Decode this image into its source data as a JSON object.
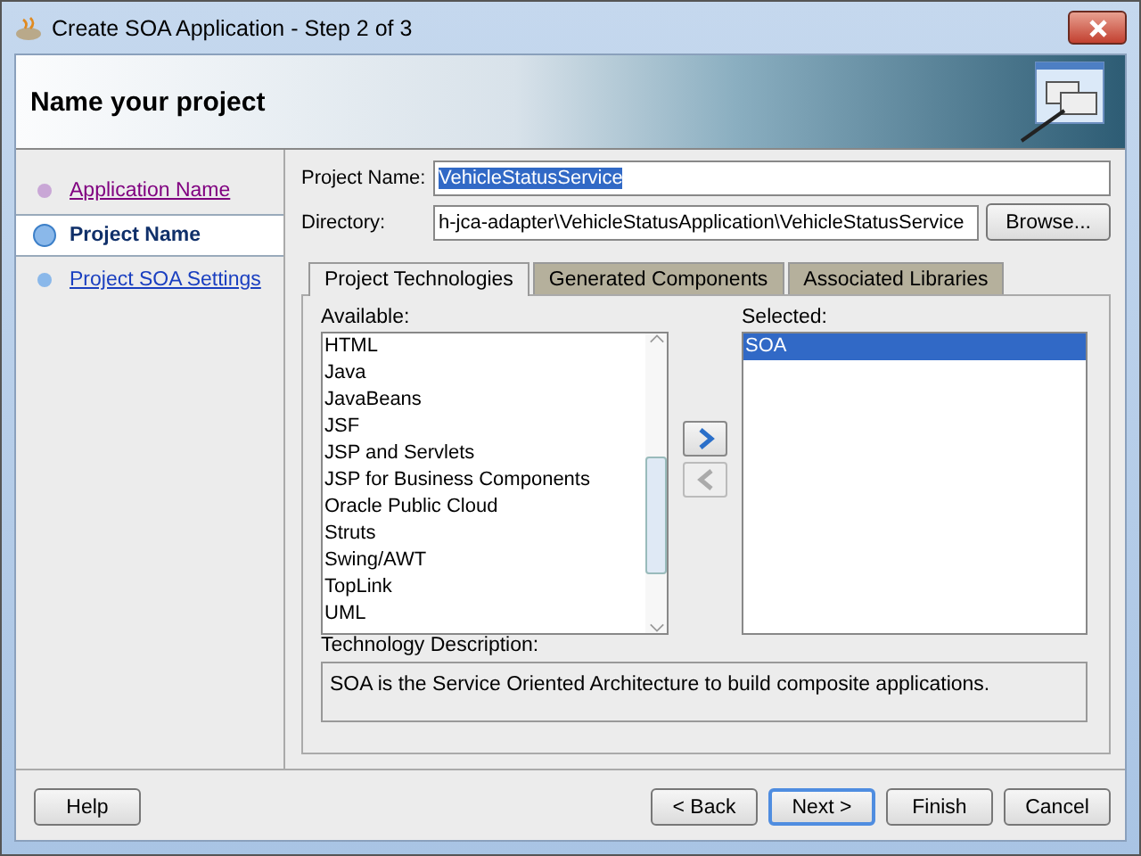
{
  "window": {
    "title": "Create SOA Application - Step 2 of 3"
  },
  "header": {
    "title": "Name your project"
  },
  "steps": [
    {
      "label": "Application Name",
      "selected": false,
      "visited": true
    },
    {
      "label": "Project Name",
      "selected": true,
      "visited": false
    },
    {
      "label": "Project SOA Settings",
      "selected": false,
      "visited": false
    }
  ],
  "project_name": {
    "label": "Project Name:",
    "value": "VehicleStatusService"
  },
  "directory": {
    "label": "Directory:",
    "value": "h-jca-adapter\\VehicleStatusApplication\\VehicleStatusService",
    "browse": "Browse..."
  },
  "tabs": [
    {
      "label": "Project Technologies",
      "selected": true
    },
    {
      "label": "Generated Components",
      "selected": false
    },
    {
      "label": "Associated Libraries",
      "selected": false
    }
  ],
  "available": {
    "label": "Available:",
    "items": [
      {
        "label": "HTML",
        "selected": false
      },
      {
        "label": "Java",
        "selected": false
      },
      {
        "label": "JavaBeans",
        "selected": false
      },
      {
        "label": "JSF",
        "selected": false
      },
      {
        "label": "JSP and Servlets",
        "selected": false
      },
      {
        "label": "JSP for Business Components",
        "selected": false
      },
      {
        "label": "Oracle Public Cloud",
        "selected": false
      },
      {
        "label": "Struts",
        "selected": false
      },
      {
        "label": "Swing/AWT",
        "selected": false
      },
      {
        "label": "TopLink",
        "selected": false
      },
      {
        "label": "UML",
        "selected": false
      }
    ]
  },
  "selected_list": {
    "label": "Selected:",
    "items": [
      {
        "label": "SOA",
        "selected": true
      }
    ]
  },
  "move_buttons": [
    {
      "kind": "add",
      "disabled": false
    },
    {
      "kind": "remove",
      "disabled": true
    }
  ],
  "description": {
    "label": "Technology Description:",
    "text": "SOA is the Service Oriented Architecture to build composite applications."
  },
  "buttons": [
    {
      "label": "Help",
      "default": false,
      "kind": "left"
    },
    {
      "label": "< Back",
      "default": false,
      "kind": "right"
    },
    {
      "label": "Next >",
      "default": true,
      "kind": "right"
    },
    {
      "label": "Finish",
      "default": false,
      "kind": "right"
    },
    {
      "label": "Cancel",
      "default": false,
      "kind": "right"
    }
  ]
}
